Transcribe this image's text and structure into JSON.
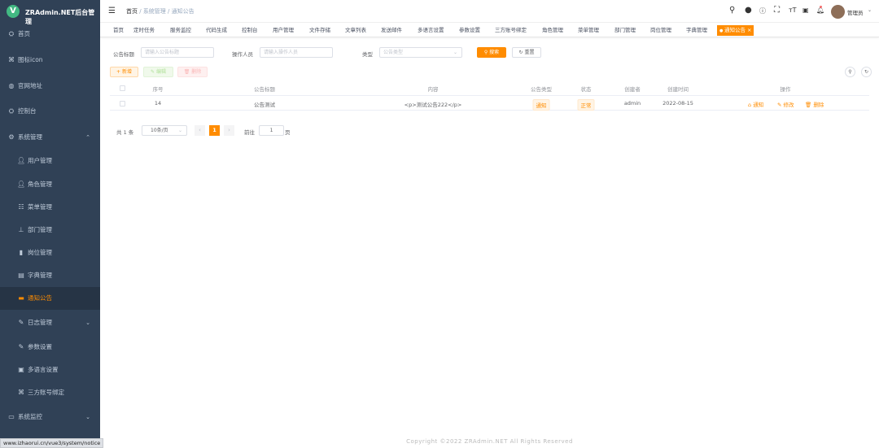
{
  "app": {
    "title": "ZRAdmin.NET后台管理",
    "logo_letter": "V"
  },
  "sidebar": {
    "items": [
      {
        "label": "首页",
        "icon": "dashboard-icon"
      },
      {
        "label": "图标icon",
        "icon": "grid-icon"
      },
      {
        "label": "官网地址",
        "icon": "globe-icon"
      },
      {
        "label": "控制台",
        "icon": "dashboard-icon"
      },
      {
        "label": "系统管理",
        "icon": "gear-icon",
        "expanded": true
      },
      {
        "label": "用户管理",
        "icon": "user-icon"
      },
      {
        "label": "角色管理",
        "icon": "role-icon"
      },
      {
        "label": "菜单管理",
        "icon": "menu-icon"
      },
      {
        "label": "部门管理",
        "icon": "tree-icon"
      },
      {
        "label": "岗位管理",
        "icon": "post-icon"
      },
      {
        "label": "字典管理",
        "icon": "dict-icon"
      },
      {
        "label": "通知公告",
        "icon": "message-icon",
        "active": true
      },
      {
        "label": "日志管理",
        "icon": "log-icon"
      },
      {
        "label": "参数设置",
        "icon": "edit-icon"
      },
      {
        "label": "多语言设置",
        "icon": "language-icon"
      },
      {
        "label": "三方账号绑定",
        "icon": "link-icon"
      },
      {
        "label": "系统监控",
        "icon": "monitor-icon"
      }
    ]
  },
  "breadcrumb": [
    "首页",
    "系统管理",
    "通知公告"
  ],
  "header": {
    "user": "管理员"
  },
  "tags": [
    "首页",
    "定时任务",
    "服务监控",
    "代码生成",
    "控制台",
    "用户管理",
    "文件存储",
    "文章列表",
    "发送邮件",
    "多语言设置",
    "参数设置",
    "三方账号绑定",
    "角色管理",
    "菜单管理",
    "部门管理",
    "岗位管理",
    "字典管理",
    "通知公告"
  ],
  "search": {
    "title_label": "公告标题",
    "title_placeholder": "请输入公告标题",
    "operator_label": "操作人员",
    "operator_placeholder": "请输入操作人员",
    "type_label": "类型",
    "type_placeholder": "公告类型",
    "search_btn": "搜索",
    "reset_btn": "重置"
  },
  "toolbar": {
    "add": "新增",
    "edit": "编辑",
    "delete": "删除"
  },
  "table": {
    "headers": [
      "序号",
      "公告标题",
      "内容",
      "公告类型",
      "状态",
      "创建者",
      "创建时间",
      "操作"
    ],
    "rows": [
      {
        "id": "14",
        "title": "公告测试",
        "content": "<p>测试公告222</p>",
        "type": "通知",
        "status": "正常",
        "creator": "admin",
        "created": "2022-08-15",
        "actions": [
          "通知",
          "修改",
          "删除"
        ]
      }
    ]
  },
  "pagination": {
    "total": "共 1 条",
    "page_size": "10条/页",
    "current": "1",
    "goto": "前往",
    "goto_value": "1",
    "page_unit": "页"
  },
  "footer": "Copyright ©2022 ZRAdmin.NET All Rights Reserved",
  "status_url": "www.izhaorui.cn/vue3/system/notice",
  "colors": {
    "accent": "#ff8c00",
    "sidebar": "#304156"
  }
}
